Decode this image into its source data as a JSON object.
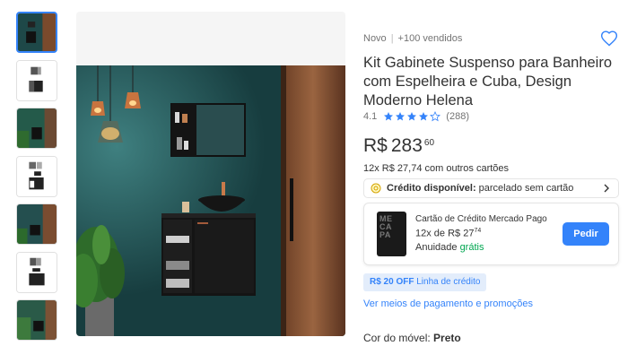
{
  "product": {
    "condition": "Novo",
    "sold": "+100 vendidos",
    "title": "Kit Gabinete Suspenso para Banheiro com Espelheira e Cuba, Design Moderno Helena",
    "rating_value": "4.1",
    "rating_stars": 4,
    "review_count": "(288)"
  },
  "price": {
    "currency": "R$",
    "amount": "283",
    "cents": "60",
    "installments": "12x R$ 27,74 com outros cartões"
  },
  "credit": {
    "label_bold": "Crédito disponível:",
    "label_rest": "parcelado sem cartão"
  },
  "card_offer": {
    "card_text": "ME\nCA\nPA",
    "title": "Cartão de Crédito Mercado Pago",
    "installment_prefix": "12x de R$ 27",
    "installment_cents": "74",
    "annual_label": "Anuidade",
    "annual_value": "grátis",
    "button": "Pedir"
  },
  "offer_badge": {
    "bold": "R$ 20 OFF",
    "rest": "Linha de crédito"
  },
  "payment_link": "Ver meios de pagamento e promoções",
  "color": {
    "label": "Cor do móvel:",
    "value": "Preto"
  },
  "icons": {
    "heart": "heart-icon",
    "star": "star-icon",
    "coin": "coin-icon",
    "chevron": "chevron-right-icon"
  },
  "colors": {
    "accent": "#3483fa",
    "green": "#00a650",
    "wall": "#1f4f4f"
  }
}
